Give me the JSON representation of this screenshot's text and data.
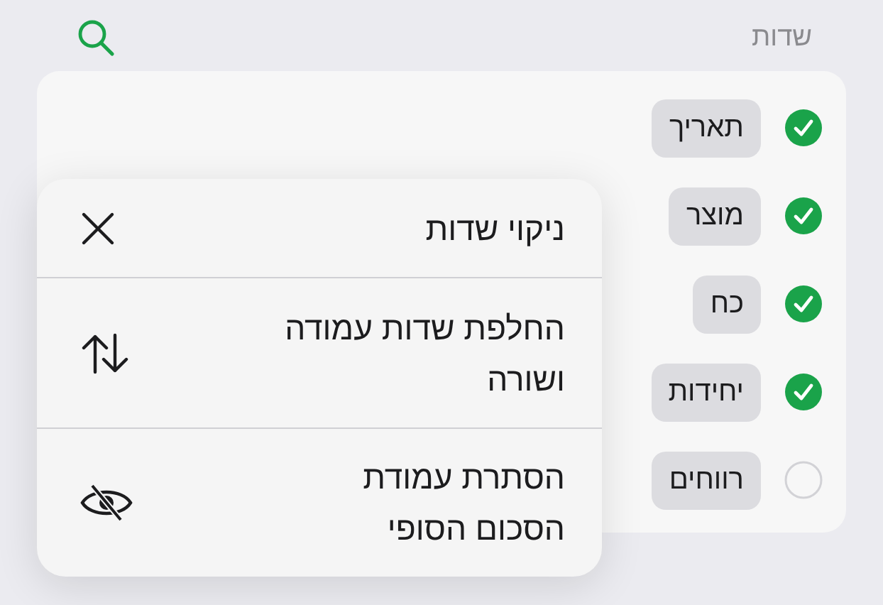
{
  "header": {
    "title": "שדות"
  },
  "fields": [
    {
      "name": "תאריך",
      "checked": true
    },
    {
      "name": "מוצר",
      "checked": true
    },
    {
      "name": "כח",
      "checked": true
    },
    {
      "name": "יחידות",
      "checked": true
    },
    {
      "name": "רווחים",
      "checked": false
    }
  ],
  "menu": [
    {
      "kind": "clear",
      "lines": [
        "ניקוי שדות"
      ]
    },
    {
      "kind": "swap",
      "lines": [
        "החלפת שדות עמודה",
        "ושורה"
      ]
    },
    {
      "kind": "hide",
      "lines": [
        "הסתרת עמודת",
        "הסכום הסופי"
      ]
    }
  ]
}
